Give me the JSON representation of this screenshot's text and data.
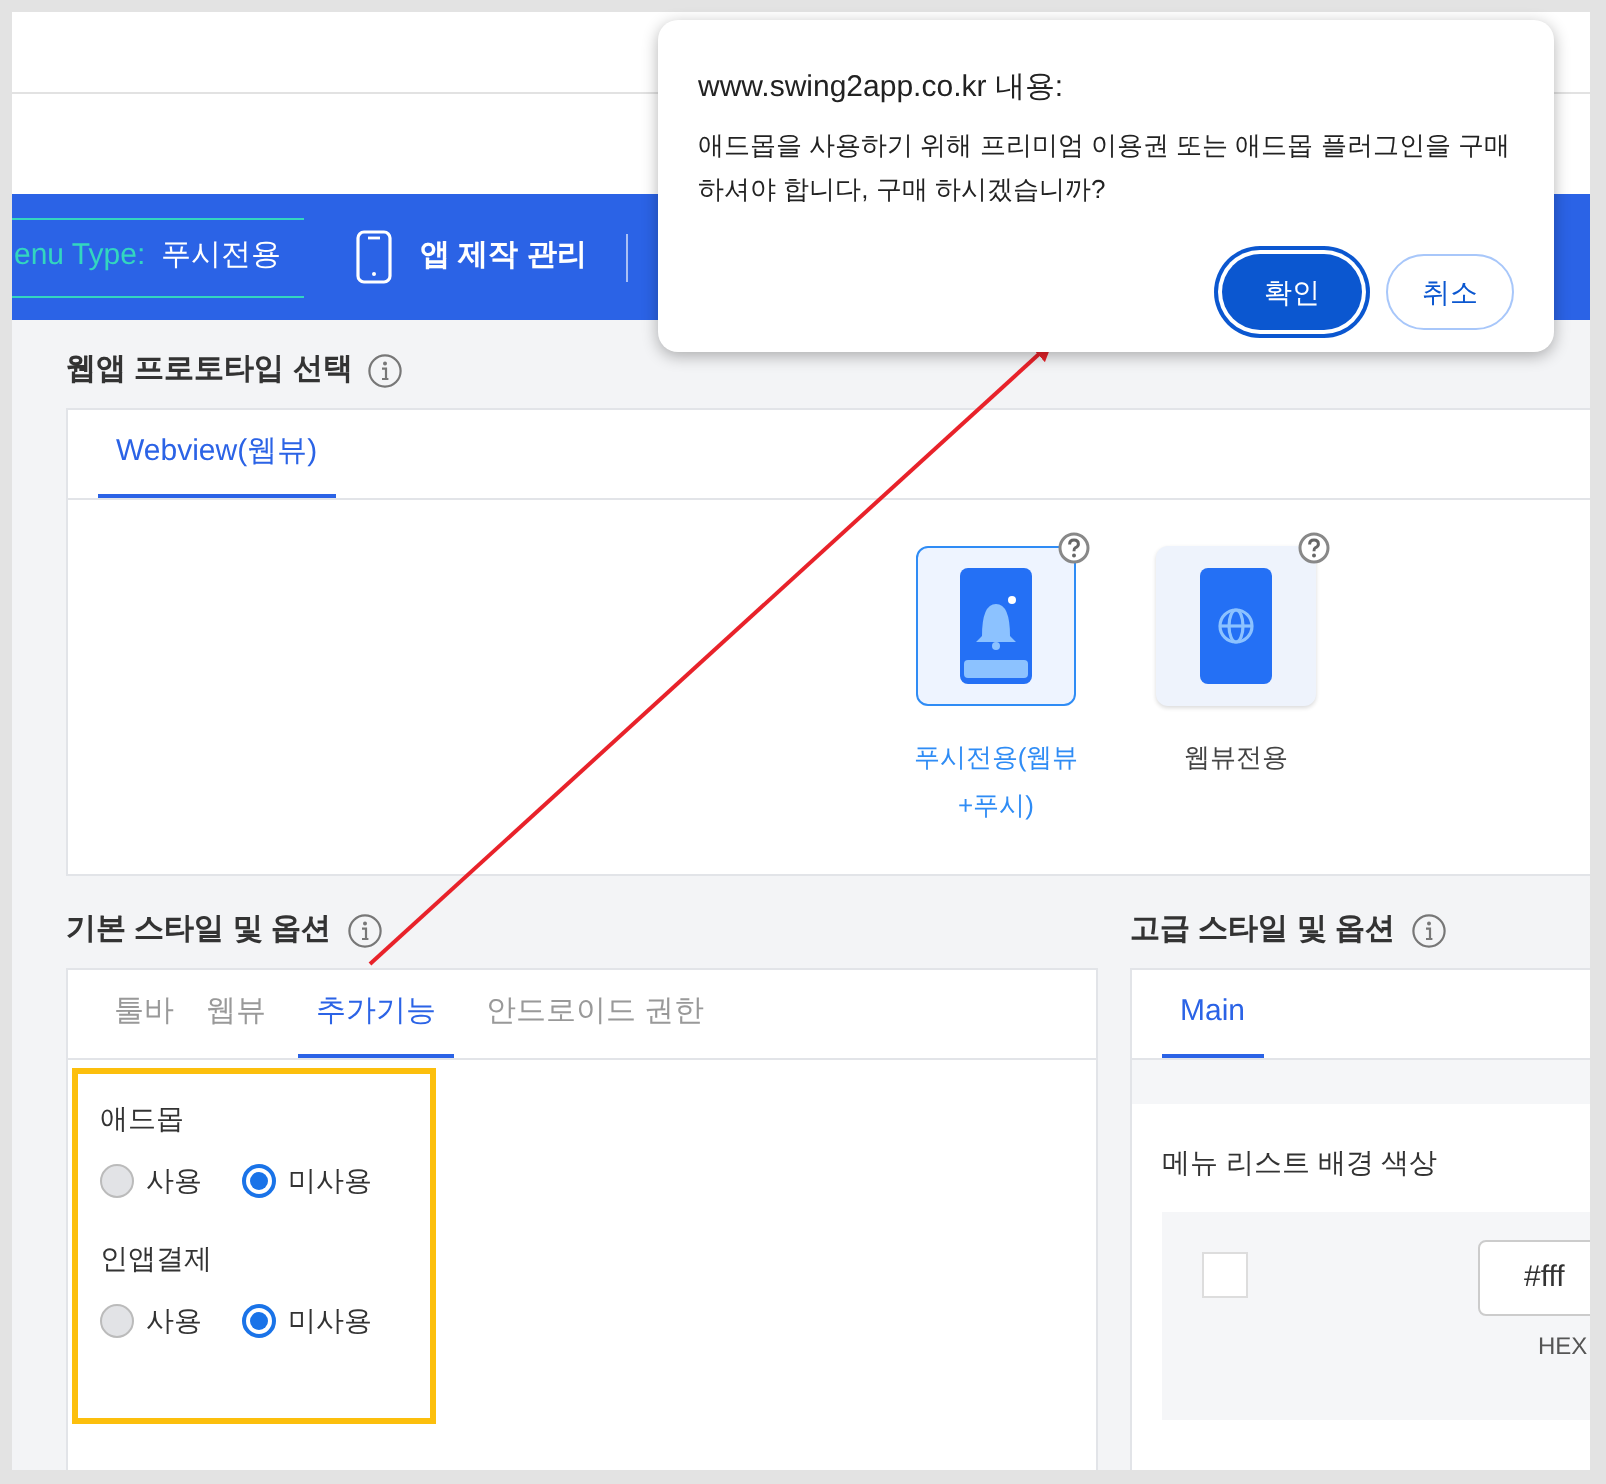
{
  "nav": {
    "menu_type_label": "enu Type:",
    "menu_type_value": "푸시전용",
    "app_manage": "앱 제작 관리"
  },
  "prototype": {
    "heading": "웹앱 프로토타입 선택",
    "tabs": [
      {
        "label": "Webview(웹뷰)",
        "selected": true
      }
    ],
    "options": [
      {
        "kind": "push",
        "label": "푸시전용(웹뷰+푸시)",
        "selected": true
      },
      {
        "kind": "webview",
        "label": "웹뷰전용",
        "selected": false
      }
    ]
  },
  "basic": {
    "heading": "기본 스타일 및 옵션",
    "tabs": [
      {
        "label": "툴바",
        "selected": false
      },
      {
        "label": "웹뷰",
        "selected": false
      },
      {
        "label": "추가기능",
        "selected": true
      },
      {
        "label": "안드로이드 권한",
        "selected": false
      }
    ],
    "groups": [
      {
        "label": "애드몹",
        "options": [
          {
            "label": "사용",
            "selected": false
          },
          {
            "label": "미사용",
            "selected": true
          }
        ]
      },
      {
        "label": "인앱결제",
        "options": [
          {
            "label": "사용",
            "selected": false
          },
          {
            "label": "미사용",
            "selected": true
          }
        ]
      }
    ]
  },
  "advanced": {
    "heading": "고급 스타일 및 옵션",
    "tabs": [
      {
        "label": "Main",
        "selected": true
      }
    ],
    "field_label": "메뉴 리스트 배경 색상",
    "color_value": "#fff",
    "color_caption": "HEX"
  },
  "dialog": {
    "title": "www.swing2app.co.kr 내용:",
    "message": "애드몹을 사용하기 위해 프리미엄 이용권 또는 애드몹 플러그인을 구매하셔야 합니다, 구매 하시겠습니까?",
    "buttons": [
      {
        "kind": "primary",
        "label": "확인"
      },
      {
        "kind": "secondary",
        "label": "취소"
      }
    ]
  }
}
